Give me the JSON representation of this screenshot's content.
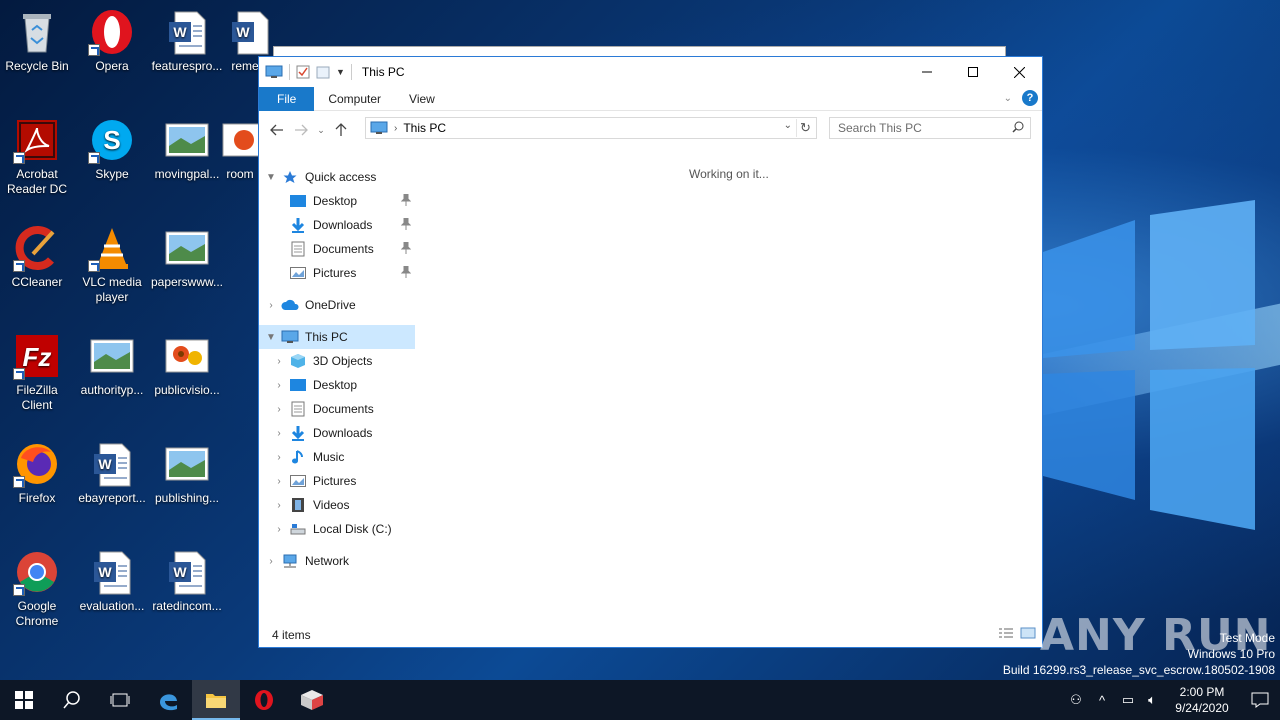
{
  "desktop": {
    "icons": [
      {
        "label": "Recycle Bin",
        "icon": "recycle-bin-icon"
      },
      {
        "label": "Opera",
        "icon": "opera-icon"
      },
      {
        "label": "featurespro...",
        "icon": "word-doc-icon"
      },
      {
        "label": "remem",
        "icon": "word-doc-icon"
      },
      {
        "label": "Acrobat Reader DC",
        "icon": "acrobat-icon"
      },
      {
        "label": "Skype",
        "icon": "skype-icon"
      },
      {
        "label": "movingpal...",
        "icon": "image-file-icon"
      },
      {
        "label": "room",
        "icon": "image-file-icon"
      },
      {
        "label": "CCleaner",
        "icon": "ccleaner-icon"
      },
      {
        "label": "VLC media player",
        "icon": "vlc-icon"
      },
      {
        "label": "paperswww...",
        "icon": "image-file-icon"
      },
      {
        "label": "FileZilla Client",
        "icon": "filezilla-icon"
      },
      {
        "label": "authorityp...",
        "icon": "image-file-icon"
      },
      {
        "label": "publicvisio...",
        "icon": "flower-image-icon"
      },
      {
        "label": "Firefox",
        "icon": "firefox-icon"
      },
      {
        "label": "ebayreport...",
        "icon": "word-doc-icon"
      },
      {
        "label": "publishing...",
        "icon": "image-file-icon"
      },
      {
        "label": "Google Chrome",
        "icon": "chrome-icon"
      },
      {
        "label": "evaluation...",
        "icon": "word-doc-icon"
      },
      {
        "label": "ratedincom...",
        "icon": "word-doc-icon"
      }
    ]
  },
  "explorer": {
    "title": "This PC",
    "tabs": {
      "file": "File",
      "computer": "Computer",
      "view": "View"
    },
    "address": "This PC",
    "search_placeholder": "Search This PC",
    "nav": {
      "quick_access": "Quick access",
      "qa_desktop": "Desktop",
      "qa_downloads": "Downloads",
      "qa_documents": "Documents",
      "qa_pictures": "Pictures",
      "onedrive": "OneDrive",
      "this_pc": "This PC",
      "objects3d": "3D Objects",
      "desktop": "Desktop",
      "documents": "Documents",
      "downloads": "Downloads",
      "music": "Music",
      "pictures": "Pictures",
      "videos": "Videos",
      "local_disk": "Local Disk (C:)",
      "network": "Network"
    },
    "content_status": "Working on it...",
    "status_items": "4 items"
  },
  "watermark": {
    "brand": "ANY RUN",
    "test_mode": "Test Mode",
    "edition": "Windows 10 Pro",
    "build": "Build 16299.rs3_release_svc_escrow.180502-1908"
  },
  "taskbar": {
    "time": "2:00 PM",
    "date": "9/24/2020"
  },
  "colors": {
    "accent": "#1979ca",
    "selection": "#cce8ff",
    "taskbar": "#0d1726"
  }
}
